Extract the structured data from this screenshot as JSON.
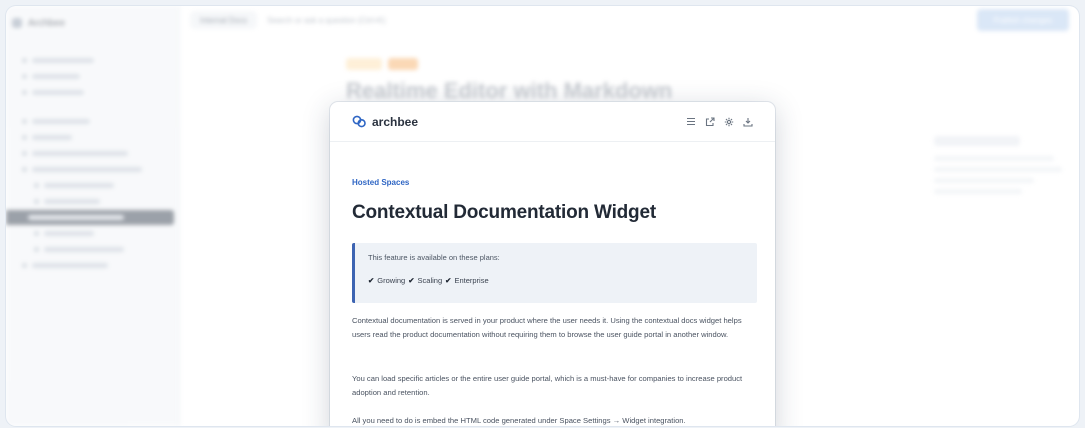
{
  "background": {
    "sidebar_title": "Archbee",
    "search_placeholder": "Search or ask a question (Ctrl+K)",
    "topbar_pill": "Internal Docs",
    "publish_button": "Publish changes",
    "doc_title": "Realtime Editor with Markdown"
  },
  "widget": {
    "brand": "archbee",
    "header_icons": [
      "menu-icon",
      "external-link-icon",
      "gear-icon",
      "download-icon"
    ],
    "breadcrumb": "Hosted Spaces",
    "title": "Contextual Documentation Widget",
    "notice": {
      "text": "This feature is available on these plans:",
      "plans": [
        "Growing",
        "Scaling",
        "Enterprise"
      ],
      "check_glyph": "✔"
    },
    "paragraphs": [
      "Contextual documentation is served in your product where the user needs it. Using the contextual docs widget helps users read the product documentation without requiring them to browse the user guide portal in another window.",
      "You can load specific articles or the entire user guide portal, which is a must-have for companies to increase product adoption and retention.",
      "All you need to do is embed the HTML code generated under Space Settings → Widget integration."
    ]
  },
  "colors": {
    "accent": "#2f66c4",
    "notice_border": "#3d64b2",
    "notice_bg": "#eef2f7"
  }
}
